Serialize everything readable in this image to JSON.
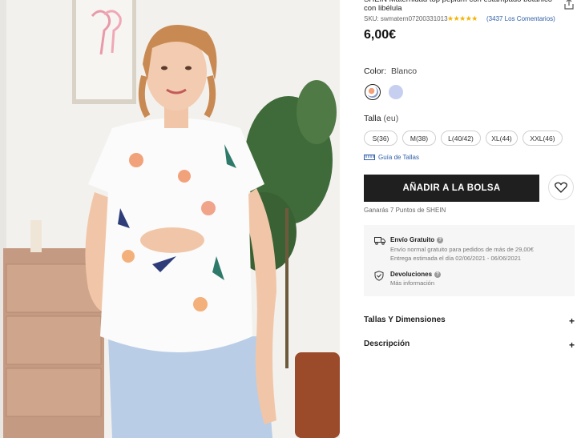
{
  "product": {
    "title": "SHEIN Maternidad top peplum con estampado botánico con libélula",
    "sku_label": "SKU:",
    "sku": "swmatern07200331013",
    "rating_stars": "★★★★★",
    "reviews": "(3437 Los Comentarios)",
    "price": "6,00€"
  },
  "color": {
    "label": "Color:",
    "value": "Blanco",
    "swatches": [
      "floral-white",
      "lavender"
    ]
  },
  "size": {
    "label": "Talla",
    "unit": "(eu)",
    "options": [
      "S(36)",
      "M(38)",
      "L(40/42)",
      "XL(44)",
      "XXL(46)"
    ],
    "guide": "Guía de Tallas"
  },
  "actions": {
    "add_to_bag": "AÑADIR A LA BOLSA",
    "points": "Ganarás 7 Puntos de SHEIN"
  },
  "shipping": {
    "title": "Envío Gratuito",
    "line1": "Envío normal gratuito para pedidos de más de 29,00€",
    "line2": "Entrega estimada el día 02/06/2021 - 06/06/2021",
    "returns_title": "Devoluciones",
    "returns_line": "Más información"
  },
  "accordions": {
    "sizes": "Tallas Y Dimensiones",
    "description": "Descripción"
  },
  "colors": {
    "button": "#1f1f1f",
    "link": "#2f5fa8",
    "star": "#f4b400"
  }
}
